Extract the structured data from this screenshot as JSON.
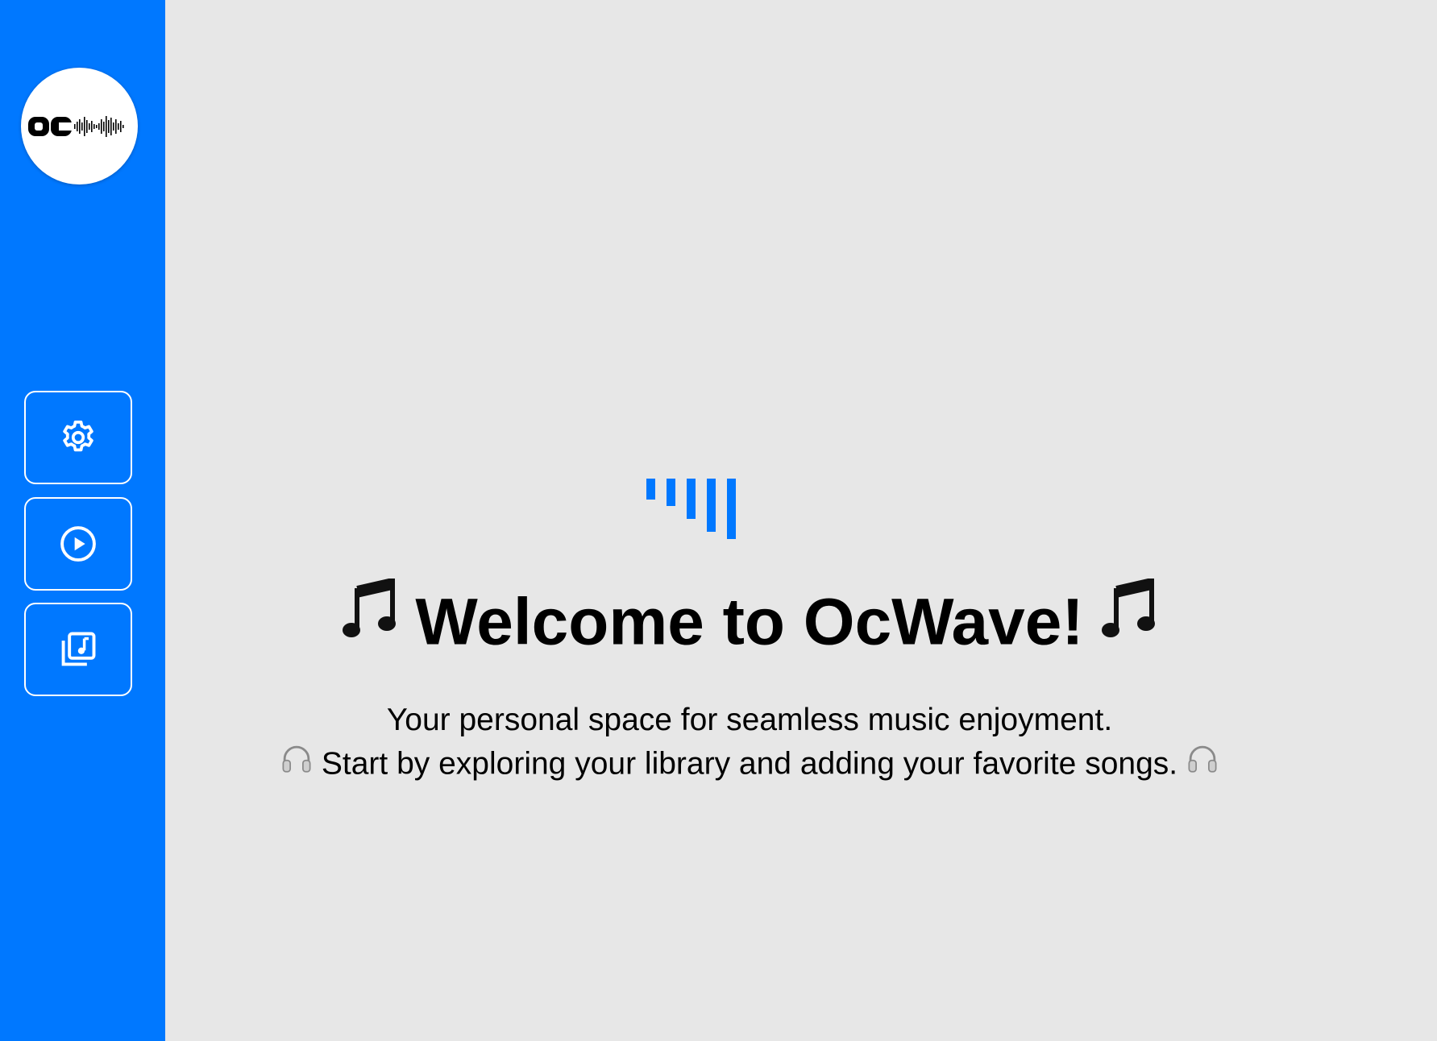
{
  "app": {
    "logo_text": "OC",
    "logo_icon": "soundwave-logo-icon"
  },
  "sidebar": {
    "items": [
      {
        "name": "settings",
        "icon": "gear-icon"
      },
      {
        "name": "player",
        "icon": "play-circle-icon"
      },
      {
        "name": "library",
        "icon": "music-library-icon"
      }
    ]
  },
  "main": {
    "title": "Welcome to OcWave!",
    "title_emoji": "music-note-icon",
    "subtitle_line1": "Your personal space for seamless music enjoyment.",
    "subtitle_line2": "Start by exploring your library and adding your favorite songs.",
    "subtitle_emoji": "headphones-icon"
  },
  "colors": {
    "accent": "#0078ff",
    "background": "#e7e7e7",
    "text": "#000000"
  }
}
